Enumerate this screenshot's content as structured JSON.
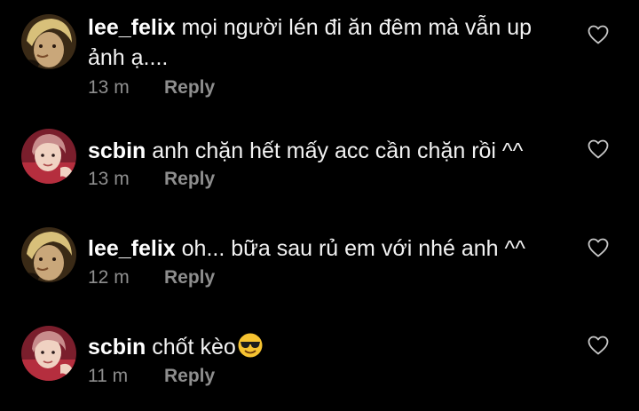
{
  "comments": [
    {
      "username": "lee_felix",
      "text": "mọi người lén đi ăn đêm mà vẫn up ảnh ạ....",
      "time": "13 m",
      "reply_label": "Reply",
      "avatar": "lee-felix-avatar"
    },
    {
      "username": "scbin",
      "text": "anh chặn hết mấy acc cần chặn rồi ^^",
      "time": "13 m",
      "reply_label": "Reply",
      "avatar": "scbin-avatar"
    },
    {
      "username": "lee_felix",
      "text": "oh... bữa sau rủ em với nhé anh ^^",
      "time": "12 m",
      "reply_label": "Reply",
      "avatar": "lee-felix-avatar"
    },
    {
      "username": "scbin",
      "text": "chốt kèo",
      "time": "11 m",
      "reply_label": "Reply",
      "avatar": "scbin-avatar",
      "emoji": "sunglasses-emoji"
    }
  ],
  "icons": {
    "like": "heart-outline-icon"
  },
  "colors": {
    "background": "#000000",
    "text": "#ffffff",
    "meta": "#8e8e8e"
  }
}
